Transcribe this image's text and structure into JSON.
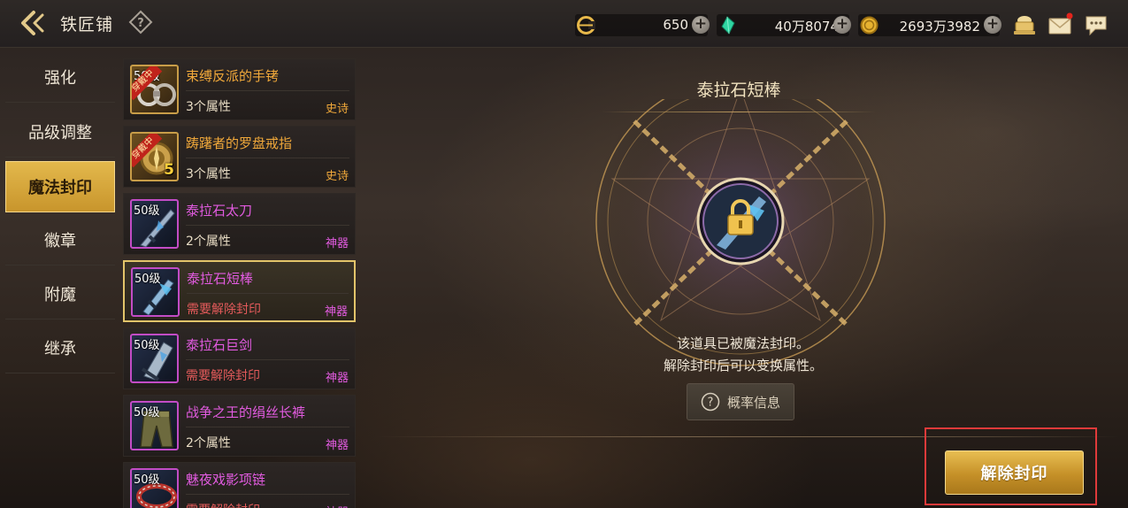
{
  "header": {
    "title": "铁匠铺",
    "currencies": [
      {
        "icon": "gold-c-icon",
        "value": "650"
      },
      {
        "icon": "green-gem-icon",
        "value": "40万8074"
      },
      {
        "icon": "gold-coin-icon",
        "value": "2693万3982"
      }
    ],
    "right_icons": [
      "treasure-chest-icon",
      "mail-icon",
      "chat-icon"
    ]
  },
  "nav": {
    "items": [
      {
        "label": "强化",
        "active": false
      },
      {
        "label": "品级调整",
        "active": false
      },
      {
        "label": "魔法封印",
        "active": true
      },
      {
        "label": "徽章",
        "active": false
      },
      {
        "label": "附魔",
        "active": false
      },
      {
        "label": "继承",
        "active": false
      }
    ]
  },
  "items": [
    {
      "name": "束缚反派的手铐",
      "level": "50级",
      "equipped_badge": "穿戴中",
      "sub": "3个属性",
      "rarity": "史诗",
      "tier": "epic",
      "selected": false
    },
    {
      "name": "踌躇者的罗盘戒指",
      "level": "",
      "equipped_badge": "穿戴中",
      "enhance": "5",
      "sub": "3个属性",
      "rarity": "史诗",
      "tier": "epic",
      "selected": false
    },
    {
      "name": "泰拉石太刀",
      "level": "50级",
      "sub": "2个属性",
      "rarity": "神器",
      "tier": "myth",
      "selected": false
    },
    {
      "name": "泰拉石短棒",
      "level": "50级",
      "sub": "需要解除封印",
      "rarity": "神器",
      "tier": "myth",
      "selected": true
    },
    {
      "name": "泰拉石巨剑",
      "level": "50级",
      "sub": "需要解除封印",
      "rarity": "神器",
      "tier": "myth",
      "selected": false
    },
    {
      "name": "战争之王的绢丝长裤",
      "level": "50级",
      "sub": "2个属性",
      "rarity": "神器",
      "tier": "myth",
      "selected": false
    },
    {
      "name": "魅夜戏影项链",
      "level": "50级",
      "sub": "需要解除封印",
      "rarity": "神器",
      "tier": "myth",
      "selected": false
    }
  ],
  "panel": {
    "item_title": "泰拉石短棒",
    "message_line1": "该道具已被魔法封印。",
    "message_line2": "解除封印后可以变换属性。",
    "probability_button": "概率信息",
    "unseal_button": "解除封印"
  },
  "colors": {
    "epic": "#f0a83a",
    "myth": "#e25be0",
    "warning": "#e25a5a",
    "gold_button": "#c59028",
    "highlight": "#e03a3a"
  }
}
